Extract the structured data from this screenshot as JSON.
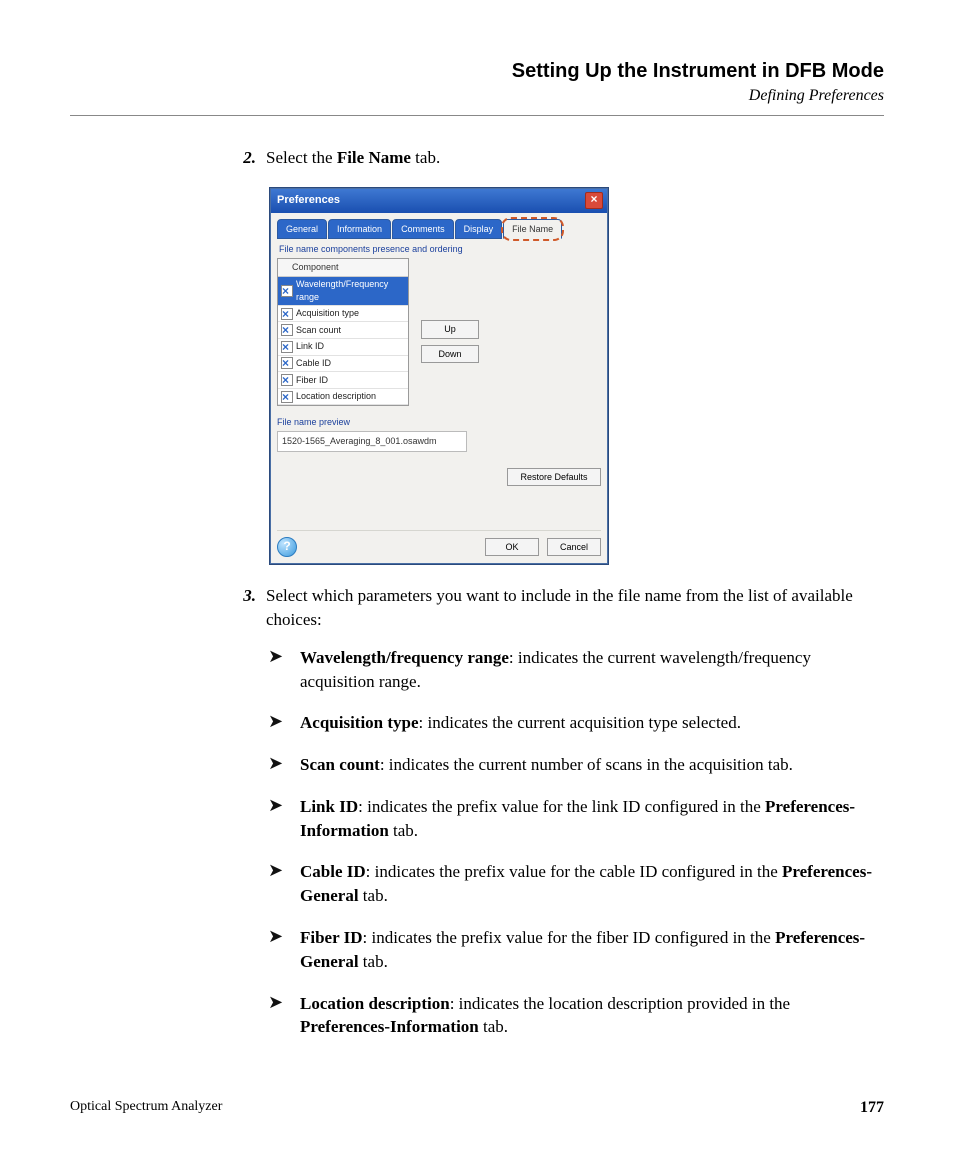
{
  "header": {
    "title": "Setting Up the Instrument in DFB Mode",
    "subtitle": "Defining Preferences"
  },
  "steps": {
    "s2": {
      "num": "2.",
      "pre": "Select the ",
      "bold": "File Name",
      "post": " tab."
    },
    "s3": {
      "num": "3.",
      "text": "Select which parameters you want to include in the file name from the list of available choices:"
    }
  },
  "dialog": {
    "title": "Preferences",
    "tabs": [
      "General",
      "Information",
      "Comments",
      "Display",
      "File Name"
    ],
    "group_label": "File name components presence and ordering",
    "col_header": "Component",
    "components": [
      "Wavelength/Frequency range",
      "Acquisition type",
      "Scan count",
      "Link ID",
      "Cable ID",
      "Fiber ID",
      "Location description"
    ],
    "up": "Up",
    "down": "Down",
    "preview_label": "File name preview",
    "preview_value": "1520-1565_Averaging_8_001.osawdm",
    "restore": "Restore Defaults",
    "ok": "OK",
    "cancel": "Cancel",
    "help": "?"
  },
  "bullets": [
    {
      "b": "Wavelength/frequency range",
      "t": ": indicates the current wavelength/frequency acquisition range."
    },
    {
      "b": "Acquisition type",
      "t": ": indicates the current acquisition type selected."
    },
    {
      "b": "Scan count",
      "t": ": indicates the current number of scans in the acquisition tab."
    },
    {
      "b": "Link ID",
      "t1": ": indicates the prefix value for the link ID configured in the ",
      "b2": "Preferences-Information",
      "t2": " tab."
    },
    {
      "b": "Cable ID",
      "t1": ": indicates the prefix value for the cable ID configured in the ",
      "b2": "Preferences-General",
      "t2": " tab."
    },
    {
      "b": "Fiber ID",
      "t1": ": indicates the prefix value for the fiber ID configured in the ",
      "b2": "Preferences-General",
      "t2": " tab."
    },
    {
      "b": "Location description",
      "t1": ": indicates the location description provided in the ",
      "b2": "Preferences-Information",
      "t2": " tab."
    }
  ],
  "footer": {
    "product": "Optical Spectrum Analyzer",
    "page": "177"
  }
}
